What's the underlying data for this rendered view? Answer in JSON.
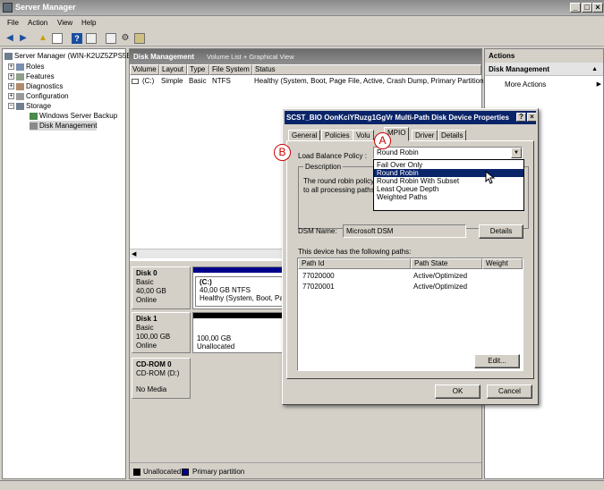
{
  "window": {
    "title": "Server Manager"
  },
  "menu": [
    "File",
    "Action",
    "View",
    "Help"
  ],
  "tree": {
    "root": "Server Manager (WIN-K2UZ5ZPS5E",
    "items": [
      "Roles",
      "Features",
      "Diagnostics",
      "Configuration",
      "Storage",
      "Windows Server Backup",
      "Disk Management"
    ]
  },
  "center": {
    "header_title": "Disk Management",
    "header_sub": "Volume List + Graphical View",
    "columns": [
      "Volume",
      "Layout",
      "Type",
      "File System",
      "Status"
    ],
    "row": {
      "volume": "(C:)",
      "layout": "Simple",
      "type": "Basic",
      "fs": "NTFS",
      "status": "Healthy (System, Boot, Page File, Active, Crash Dump, Primary Partition)"
    }
  },
  "disks": [
    {
      "name": "Disk 0",
      "type": "Basic",
      "size": "40,00 GB",
      "state": "Online",
      "vol_name": "(C:)",
      "vol_size": "40,00 GB NTFS",
      "vol_status": "Healthy (System, Boot, Pa"
    },
    {
      "name": "Disk 1",
      "type": "Basic",
      "size": "100,00 GB",
      "state": "Online",
      "vol_size": "100,00 GB",
      "vol_status": "Unallocated"
    },
    {
      "name": "CD-ROM 0",
      "type": "CD-ROM (D:)",
      "state": "No Media"
    }
  ],
  "legend": {
    "unallocated": "Unallocated",
    "primary": "Primary partition",
    "colors": {
      "unallocated": "#000000",
      "primary": "#00008b"
    }
  },
  "actions": {
    "title": "Actions",
    "section": "Disk Management",
    "more": "More Actions"
  },
  "dialog": {
    "title": "SCST_BIO OonKciYRuzg1GgVr  Multi-Path Disk Device Properties",
    "tabs": [
      "General",
      "Policies",
      "Volu",
      "MPIO",
      "Driver",
      "Details"
    ],
    "active_tab": "MPIO",
    "lb_label": "Load Balance Policy :",
    "lb_value": "Round Robin",
    "options": [
      "Fail Over Only",
      "Round Robin",
      "Round Robin With Subset",
      "Least Queue Depth",
      "Weighted Paths"
    ],
    "selected_option": "Round Robin",
    "description_label": "Description",
    "description_text_1": "The round robin policy",
    "description_text_2": "to all processing paths.",
    "dsm_label": "DSM Name:",
    "dsm_value": "Microsoft DSM",
    "details_btn": "Details",
    "paths_label": "This device has the following paths:",
    "path_columns": [
      "Path Id",
      "Path State",
      "Weight"
    ],
    "paths": [
      {
        "id": "77020000",
        "state": "Active/Optimized"
      },
      {
        "id": "77020001",
        "state": "Active/Optimized"
      }
    ],
    "edit_btn": "Edit...",
    "ok_btn": "OK",
    "cancel_btn": "Cancel"
  },
  "callouts": {
    "a": "A",
    "b": "B"
  }
}
